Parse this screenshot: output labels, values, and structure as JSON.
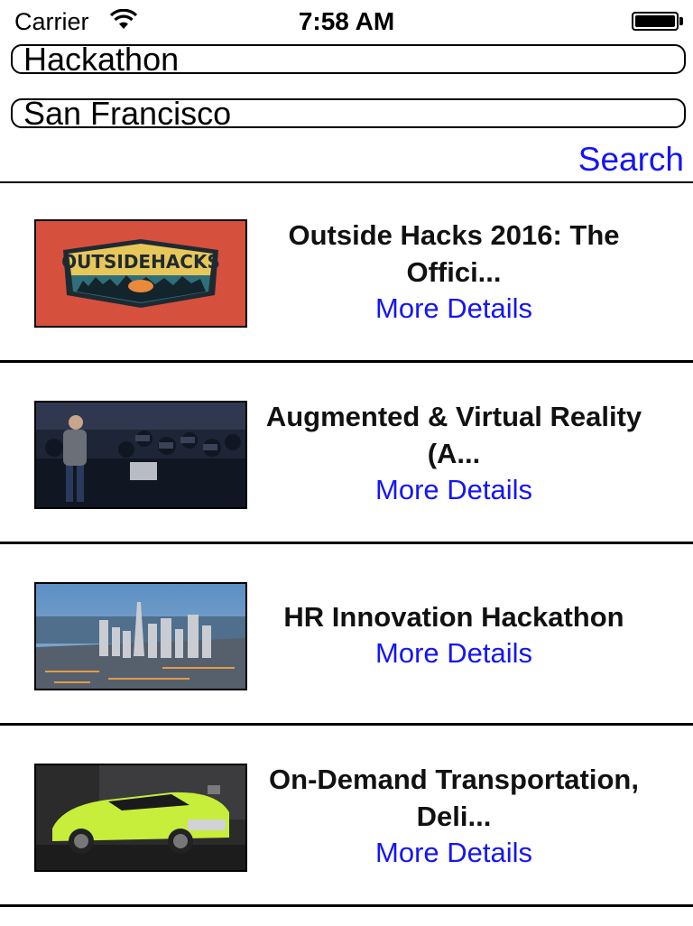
{
  "status_bar": {
    "carrier": "Carrier",
    "time": "7:58 AM",
    "wifi_icon": "wifi-icon",
    "battery_icon": "battery-icon",
    "battery_level": 1.0
  },
  "search": {
    "keyword_value": "Hackathon",
    "location_value": "San Francisco",
    "search_label": "Search"
  },
  "colors": {
    "link": "#1515f5",
    "thumb1_bg": "#d6503e",
    "thumb2_bg": "#1d2536",
    "thumb3_bg": "#4b78a8",
    "thumb4_bg": "#2b2b2b"
  },
  "events": [
    {
      "title": "Outside Hacks 2016: The Offici...",
      "link": "More Details",
      "image": "outside-hacks-logo"
    },
    {
      "title": "Augmented & Virtual Reality (A...",
      "link": "More Details",
      "image": "vr-audience-photo"
    },
    {
      "title": "HR Innovation Hackathon",
      "link": "More Details",
      "image": "san-francisco-aerial-photo"
    },
    {
      "title": "On-Demand Transportation, Deli...",
      "link": "More Details",
      "image": "green-sports-car-photo"
    }
  ],
  "logo_text": "OUTSIDEHACKS"
}
